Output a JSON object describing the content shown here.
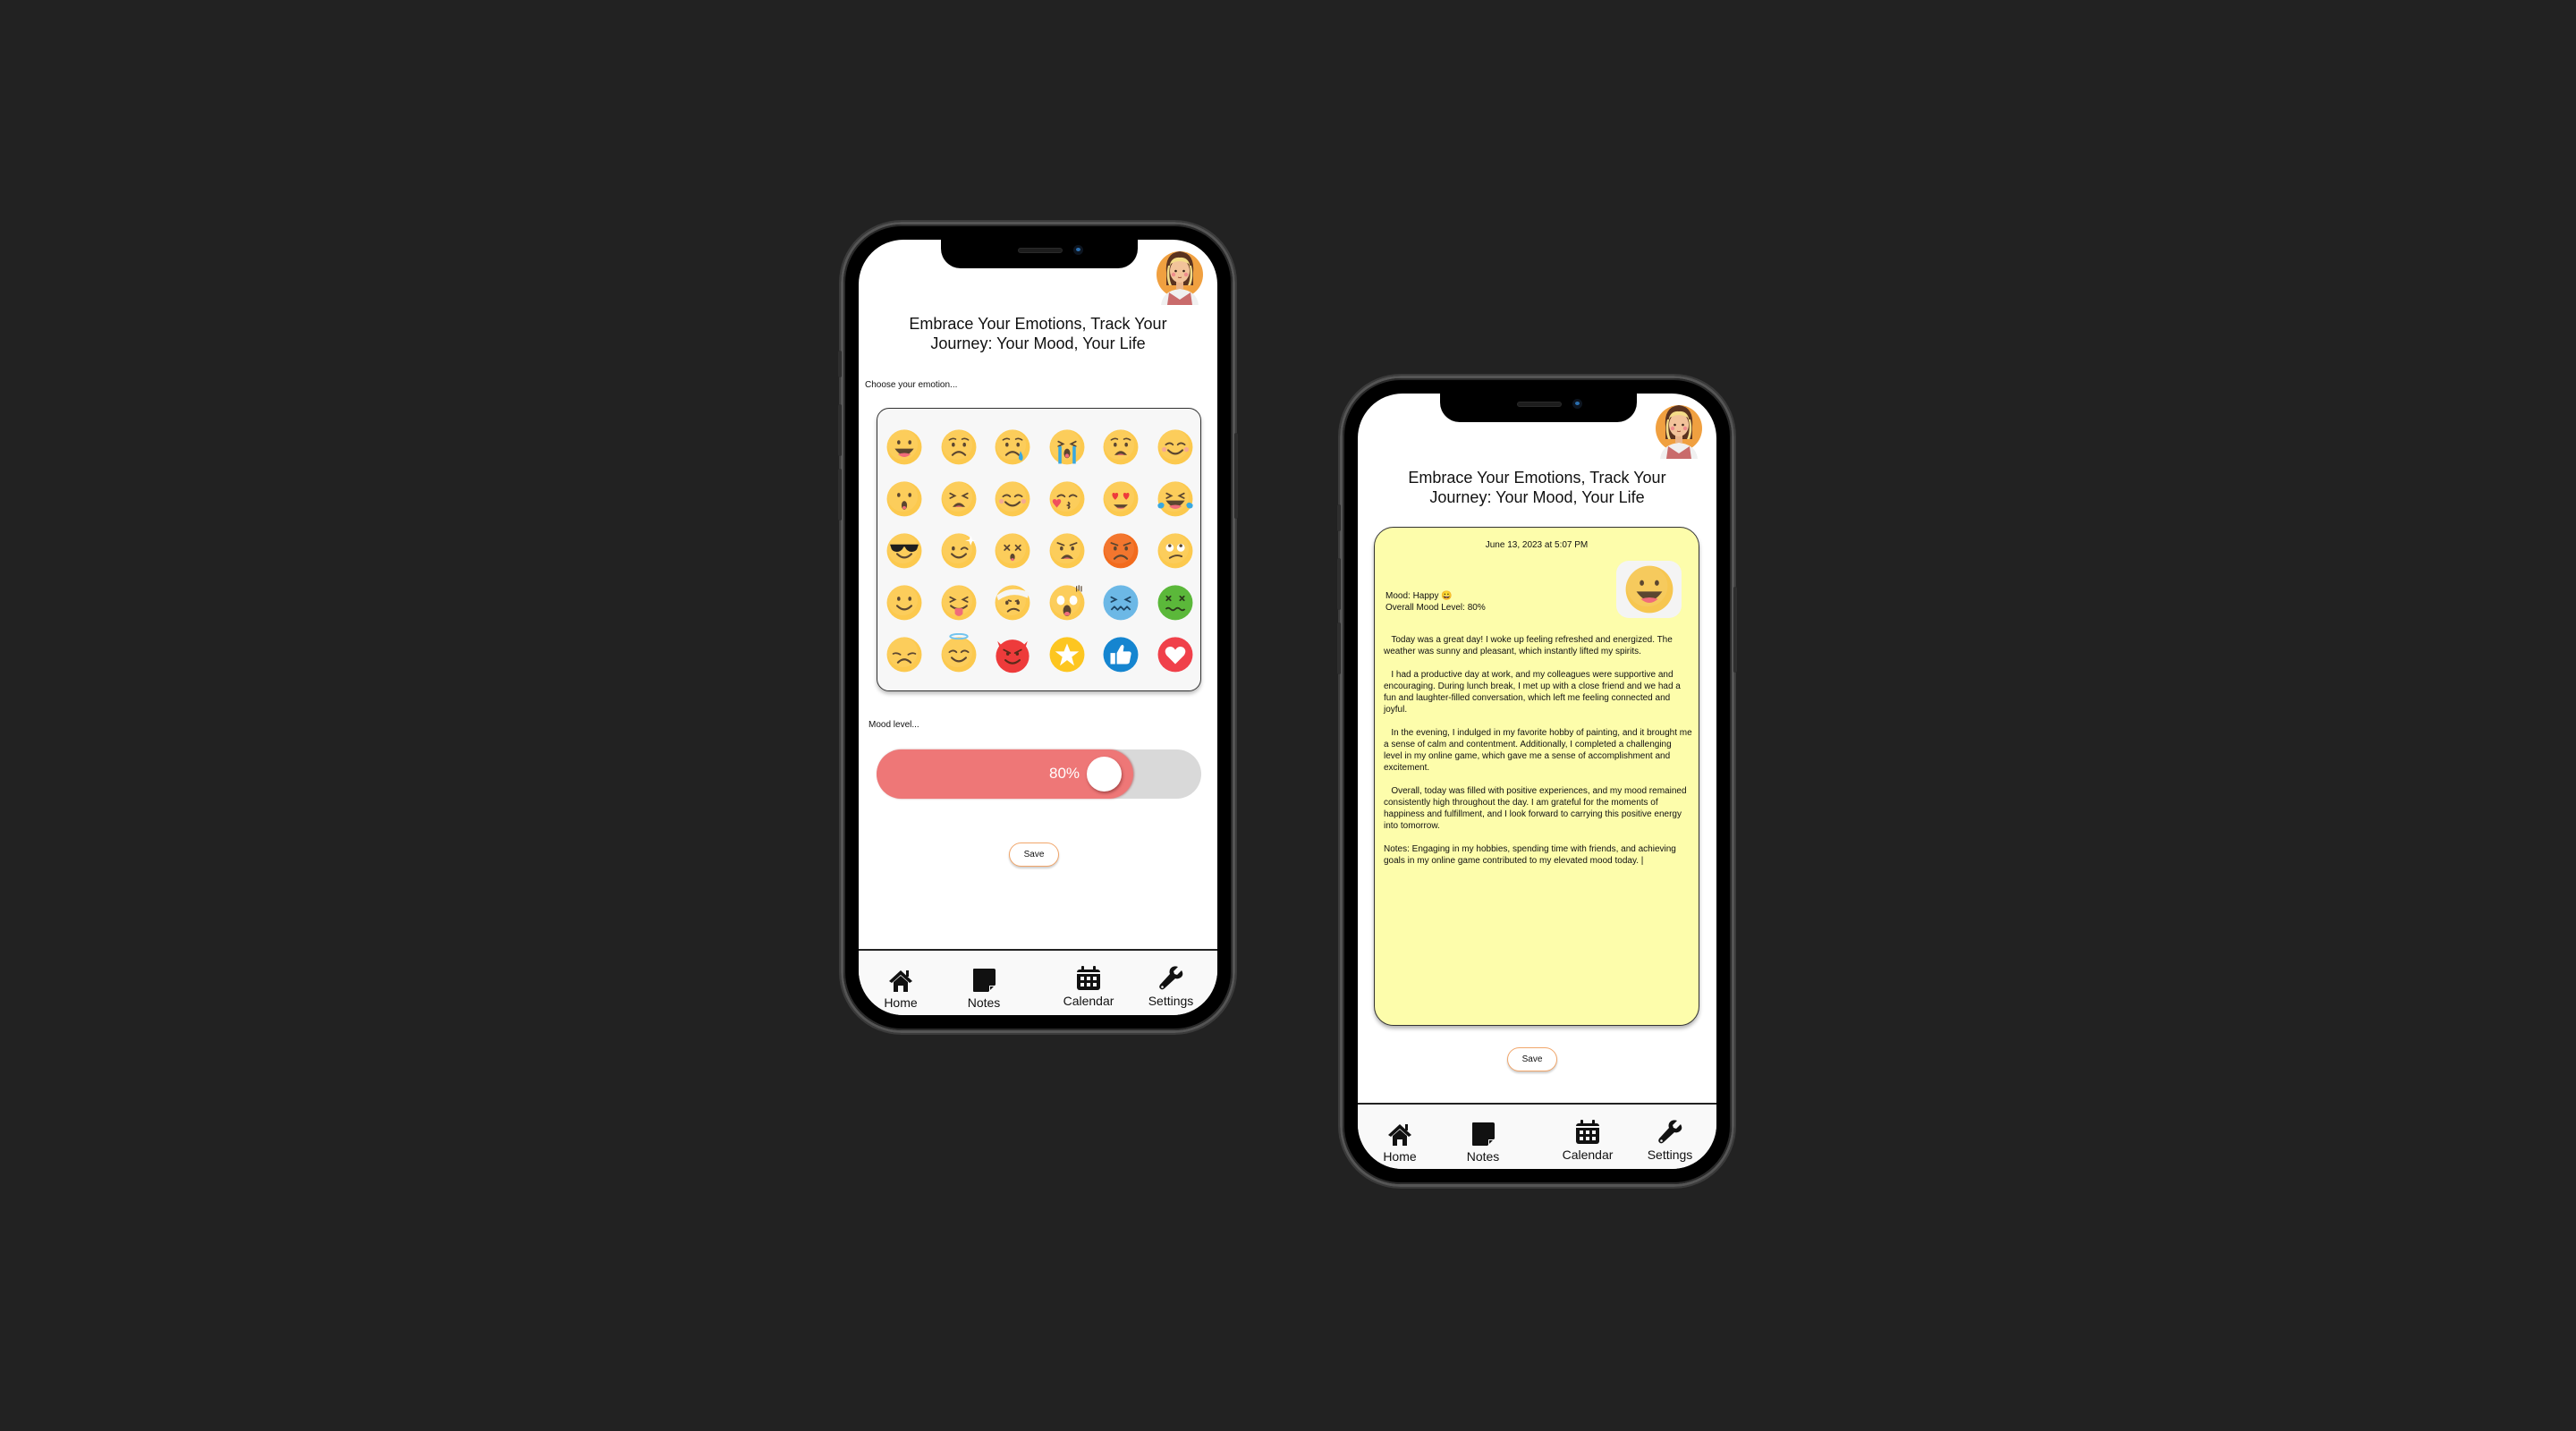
{
  "app": {
    "title_line1": "Embrace Your Emotions, Track Your",
    "title_line2": "Journey: Your Mood, Your Life",
    "avatar": "woman-avatar"
  },
  "colors": {
    "background": "#222222",
    "slider_fill": "#ee7777",
    "slider_track": "#d9d9d9",
    "save_border": "#f1a66a",
    "journal_card": "#fdfdab",
    "avatar_circle": "#f0a040"
  },
  "mood_screen": {
    "choose_label": "Choose your emotion...",
    "emotions": [
      {
        "name": "grinning",
        "color": "#fcc94e"
      },
      {
        "name": "worried",
        "color": "#fcc94e"
      },
      {
        "name": "sad-tear",
        "color": "#fcc94e"
      },
      {
        "name": "loudly-crying",
        "color": "#fcc94e"
      },
      {
        "name": "anguished",
        "color": "#fcc94e"
      },
      {
        "name": "relieved-blush",
        "color": "#fcc94e"
      },
      {
        "name": "surprised",
        "color": "#fcc94e"
      },
      {
        "name": "tired-squint",
        "color": "#fcc94e"
      },
      {
        "name": "smiling-blush",
        "color": "#fcc94e"
      },
      {
        "name": "kissing-heart",
        "color": "#fcc94e"
      },
      {
        "name": "heart-eyes",
        "color": "#fcc94e"
      },
      {
        "name": "tears-of-joy",
        "color": "#fcc94e"
      },
      {
        "name": "sunglasses",
        "color": "#fcc94e"
      },
      {
        "name": "winking-sparkle",
        "color": "#fcc94e"
      },
      {
        "name": "dizzy-x-eyes",
        "color": "#fcc94e"
      },
      {
        "name": "angry",
        "color": "#fcc94e"
      },
      {
        "name": "furious-orange",
        "color": "#f26b1d"
      },
      {
        "name": "eye-roll",
        "color": "#fcc94e"
      },
      {
        "name": "slight-smile",
        "color": "#fcc94e"
      },
      {
        "name": "tongue-squint",
        "color": "#fcc94e"
      },
      {
        "name": "bandaged-head",
        "color": "#fcc94e"
      },
      {
        "name": "shocked",
        "color": "#fcc94e"
      },
      {
        "name": "cold-blue",
        "color": "#6cb8e6"
      },
      {
        "name": "sick-green",
        "color": "#5bb83a"
      },
      {
        "name": "pensive",
        "color": "#fcc94e"
      },
      {
        "name": "angel-halo",
        "color": "#fcc94e"
      },
      {
        "name": "devil",
        "color": "#ee3b3b"
      },
      {
        "name": "star",
        "color": "#fdc620"
      },
      {
        "name": "thumbs-up",
        "color": "#1585d0"
      },
      {
        "name": "heart",
        "color": "#f0404a"
      }
    ],
    "mood_label": "Mood level...",
    "mood_level_percent": 80,
    "mood_level_text": "80%",
    "save_label": "Save"
  },
  "journal_screen": {
    "date": "June 13, 2023 at 5:07 PM",
    "mood_line": "Mood: Happy 😀",
    "mood_level_line": "Overall Mood Level: 80%",
    "selected_emotion": "grinning",
    "paragraphs": [
      "   Today was a great day! I woke up feeling refreshed and energized. The weather was sunny and pleasant, which instantly lifted my spirits.",
      "   I had a productive day at work, and my colleagues were supportive and encouraging. During lunch break, I met up with a close friend and we had a fun and laughter-filled conversation, which left me feeling connected and joyful.",
      "   In the evening, I indulged in my favorite hobby of painting, and it brought me a sense of calm and contentment. Additionally, I completed a challenging level in my online game, which gave me a sense of accomplishment and excitement.",
      "   Overall, today was filled with positive experiences, and my mood remained consistently high throughout the day. I am grateful for the moments of happiness and fulfillment, and I look forward to carrying this positive energy into tomorrow.",
      "Notes: Engaging in my hobbies, spending time with friends, and achieving goals in my online game contributed to my elevated mood today. |"
    ],
    "save_label": "Save"
  },
  "nav": {
    "items": [
      {
        "label": "Home",
        "icon": "home-icon"
      },
      {
        "label": "Notes",
        "icon": "notes-icon"
      },
      {
        "label": "Calendar",
        "icon": "calendar-icon"
      },
      {
        "label": "Settings",
        "icon": "wrench-icon"
      }
    ]
  }
}
